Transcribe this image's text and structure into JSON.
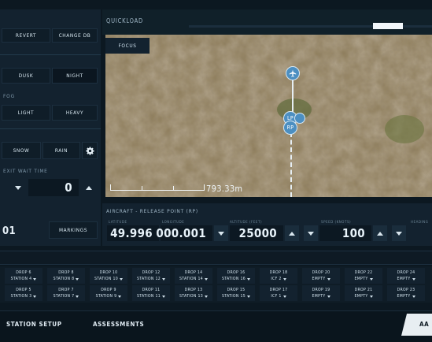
{
  "left": {
    "revert_label": "REVERT",
    "change_db_label": "CHANGE DB",
    "dusk_label": "DUSK",
    "night_label": "NIGHT",
    "fog_header": "FOG",
    "light_label": "LIGHT",
    "heavy_label": "HEAVY",
    "snow_label": "SNOW",
    "rain_label": "RAIN",
    "exit_wait_header": "EXIT WAIT TIME",
    "exit_wait_value": "0",
    "partial_value": "01",
    "markings_label": "MARKINGS"
  },
  "quickload": {
    "label": "QUICKLOAD",
    "focus_label": "FOCUS"
  },
  "map": {
    "scale_text": "793.33m",
    "lp_label": "LP",
    "rp_label": "RP"
  },
  "release": {
    "title": "AIRCRAFT - RELEASE POINT (RP)",
    "latitude_label": "LATITUDE",
    "latitude_value": "49.996",
    "longitude_label": "LONGITUDE",
    "longitude_value": "000.001",
    "altitude_label": "ALTITUDE (FEET)",
    "altitude_value": "25000",
    "speed_label": "SPEED (KNOTS)",
    "speed_value": "100",
    "heading_label": "HEADING"
  },
  "drops_top": [
    {
      "drop": "DROP 6",
      "station": "STATION 4"
    },
    {
      "drop": "DROP 8",
      "station": "STATION 8"
    },
    {
      "drop": "DROP 10",
      "station": "STATION 10"
    },
    {
      "drop": "DROP 12",
      "station": "STATION 12"
    },
    {
      "drop": "DROP 14",
      "station": "STATION 14"
    },
    {
      "drop": "DROP 16",
      "station": "STATION 16"
    },
    {
      "drop": "DROP 18",
      "station": "ICF 2"
    },
    {
      "drop": "DROP 20",
      "station": "EMPTY"
    },
    {
      "drop": "DROP 22",
      "station": "EMPTY"
    },
    {
      "drop": "DROP 24",
      "station": "EMPTY"
    }
  ],
  "drops_bottom": [
    {
      "drop": "DROP 5",
      "station": "STATION 3"
    },
    {
      "drop": "DROP 7",
      "station": "STATION 7"
    },
    {
      "drop": "DROP 9",
      "station": "STATION 9"
    },
    {
      "drop": "DROP 11",
      "station": "STATION 11"
    },
    {
      "drop": "DROP 13",
      "station": "STATION 13"
    },
    {
      "drop": "DROP 15",
      "station": "STATION 15"
    },
    {
      "drop": "DROP 17",
      "station": "ICF 1"
    },
    {
      "drop": "DROP 19",
      "station": "EMPTY"
    },
    {
      "drop": "DROP 21",
      "station": "EMPTY"
    },
    {
      "drop": "DROP 23",
      "station": "EMPTY"
    }
  ],
  "tabs": {
    "station_setup": "STATION SETUP",
    "assessments": "ASSESSMENTS",
    "right_partial": "AA"
  },
  "colors": {
    "background": "#0c1821",
    "panel": "#152635",
    "marker": "#4c8fc1"
  }
}
